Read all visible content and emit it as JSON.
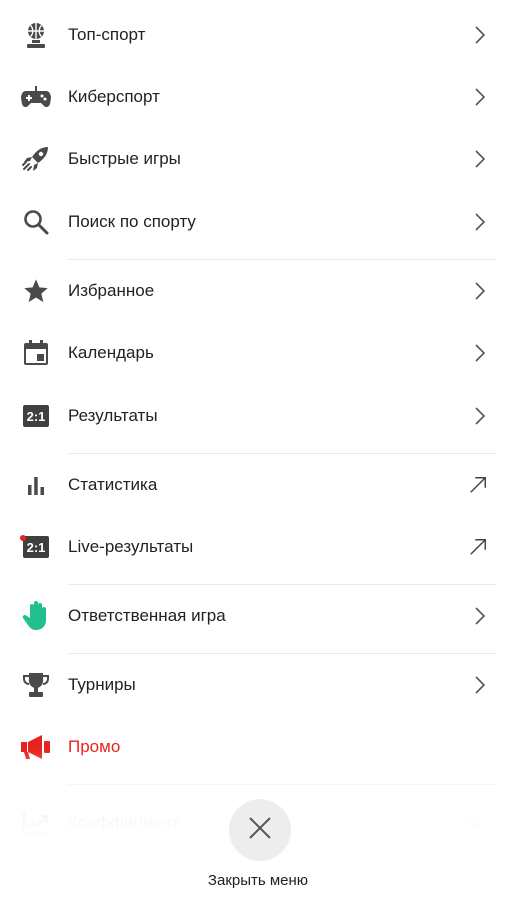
{
  "menu": {
    "items": [
      {
        "label": "Топ-спорт",
        "icon": "basketball-trophy-icon",
        "arrow": "chevron-right"
      },
      {
        "label": "Киберспорт",
        "icon": "gamepad-icon",
        "arrow": "chevron-right"
      },
      {
        "label": "Быстрые игры",
        "icon": "rocket-icon",
        "arrow": "chevron-right"
      },
      {
        "label": "Поиск по спорту",
        "icon": "search-icon",
        "arrow": "chevron-right"
      },
      {
        "label": "Избранное",
        "icon": "star-icon",
        "arrow": "chevron-right"
      },
      {
        "label": "Календарь",
        "icon": "calendar-icon",
        "arrow": "chevron-right"
      },
      {
        "label": "Результаты",
        "icon": "score-icon",
        "icon_text": "2:1",
        "arrow": "chevron-right"
      },
      {
        "label": "Статистика",
        "icon": "bar-chart-icon",
        "arrow": "external-arrow"
      },
      {
        "label": "Live-результаты",
        "icon": "live-score-icon",
        "icon_text": "2:1",
        "arrow": "external-arrow"
      },
      {
        "label": "Ответственная игра",
        "icon": "hand-icon",
        "arrow": "chevron-right"
      },
      {
        "label": "Турниры",
        "icon": "trophy-icon",
        "arrow": "chevron-right"
      },
      {
        "label": "Промо",
        "icon": "megaphone-icon",
        "arrow": "none"
      },
      {
        "label": "Коэффициент",
        "icon": "line-chart-icon",
        "arrow": "chevron-down"
      }
    ]
  },
  "colors": {
    "text": "#222222",
    "icon": "#4a4a4a",
    "promo": "#e8231f",
    "hand": "#22c08f",
    "live_dot": "#e8231f",
    "divider": "#e8e8e8"
  },
  "close": {
    "label": "Закрыть меню",
    "icon": "close-icon"
  }
}
